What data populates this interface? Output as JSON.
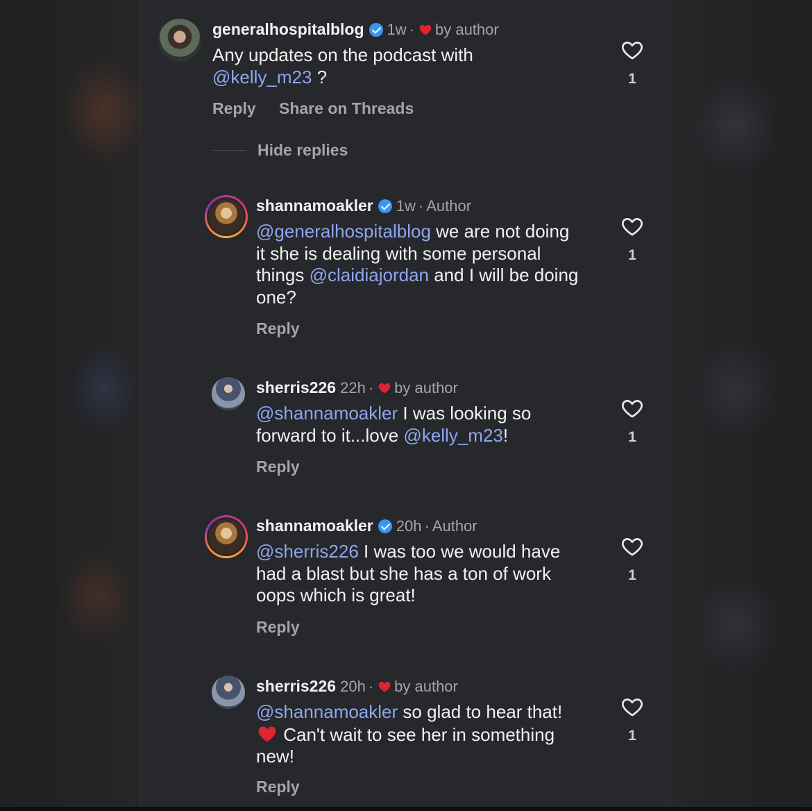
{
  "comments": [
    {
      "username": "generalhospitalblog",
      "verified": true,
      "time": "1w",
      "sep": "·",
      "badge": "by author",
      "text": [
        "Any updates on the podcast with ",
        "@kelly_m23",
        " ?"
      ],
      "actions": [
        "Reply",
        "Share on Threads"
      ],
      "likes": "1"
    },
    {
      "username": "shannamoakler",
      "verified": true,
      "time": "1w",
      "sep": "·",
      "badge": "Author",
      "text": [
        "@generalhospitalblog",
        " we are not doing it she is dealing with some personal things ",
        "@claidiajordan",
        " and I will be doing one?"
      ],
      "reply": "Reply",
      "likes": "1"
    },
    {
      "username": "sherris226",
      "time": "22h",
      "sep": "·",
      "badge": "by author",
      "text": [
        "@shannamoakler",
        " I was looking so forward to it...love ",
        "@kelly_m23",
        "!"
      ],
      "reply": "Reply",
      "likes": "1"
    },
    {
      "username": "shannamoakler",
      "verified": true,
      "time": "20h",
      "sep": "·",
      "badge": "Author",
      "text": [
        "@sherris226",
        " I was too we would have had a blast but she has a ton of work oops which is great!"
      ],
      "reply": "Reply",
      "likes": "1"
    },
    {
      "username": "sherris226",
      "time": "20h",
      "sep": "·",
      "badge": "by author",
      "text": [
        "@shannamoakler",
        " so glad to hear that! ",
        " Can't wait to see her in something new!"
      ],
      "reply": "Reply",
      "likes": "1"
    }
  ],
  "hide_replies": "Hide replies",
  "icons": [
    "verified-badge-icon",
    "heart-outline-icon",
    "heart-filled-icon",
    "red-heart-emoji"
  ],
  "colors": {
    "mention": "#8ea6ee",
    "verified": "#3897f0",
    "heart": "#e0242f",
    "panel": "#27282c"
  }
}
